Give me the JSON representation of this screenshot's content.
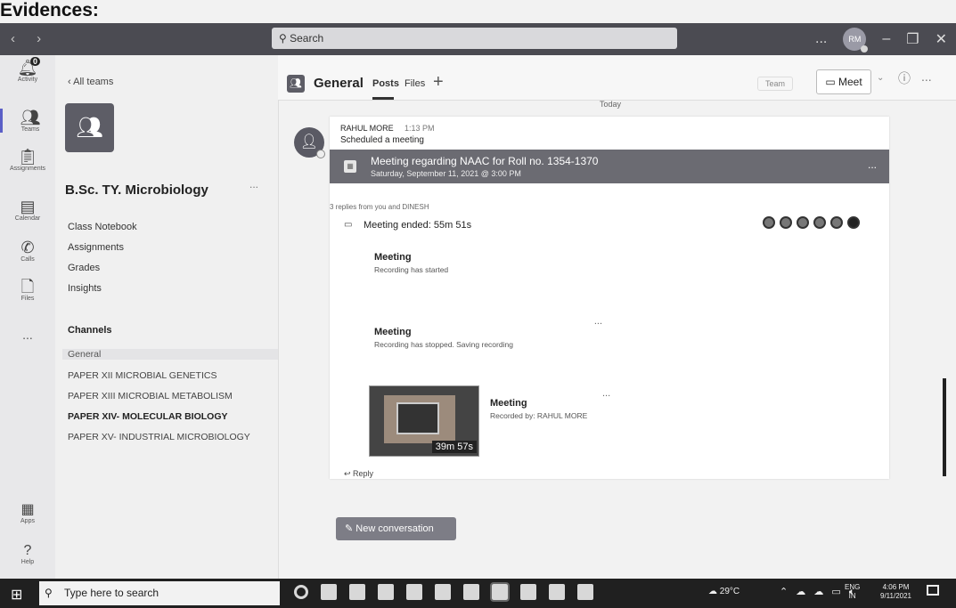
{
  "caption": "Evidences:",
  "topbar": {
    "nav": "‹ ›",
    "search_placeholder": "Search",
    "more": "...",
    "avatar_initials": "RM",
    "minimize": "–",
    "maximize": "❐",
    "close": "✕"
  },
  "rail": {
    "activity_label": "Activity",
    "activity_badge": "0",
    "teams_label": "Teams",
    "assignments_label": "Assignments",
    "calendar_label": "Calendar",
    "calls_label": "Calls",
    "files_label": "Files",
    "more": "...",
    "apps_label": "Apps",
    "help_label": "Help"
  },
  "teampanel": {
    "all_teams": "‹  All teams",
    "team_name": "B.Sc. TY. Microbiology",
    "team_more": "...",
    "links": [
      "Class Notebook",
      "Assignments",
      "Grades",
      "Insights"
    ],
    "channels_heading": "Channels",
    "channels": [
      "General",
      "PAPER XII MICROBIAL GENETICS",
      "PAPER XIII MICROBIAL METABOLISM",
      "PAPER XIV- MOLECULAR BIOLOGY",
      "PAPER XV- INDUSTRIAL MICROBIOLOGY"
    ]
  },
  "channel": {
    "title": "General",
    "tabs": [
      "Posts",
      "Files"
    ],
    "add": "+",
    "team_btn": "Team",
    "meet_btn": "Meet",
    "info": "ⓘ",
    "more": "..."
  },
  "conversation": {
    "day": "Today",
    "author": "RAHUL MORE",
    "time": "1:13 PM",
    "text": "Scheduled a meeting",
    "meeting_title": "Meeting regarding NAAC for Roll no. 1354-1370",
    "meeting_date": "Saturday, September 11, 2021 @ 3:00 PM",
    "meeting_more": "...",
    "replies": "3 replies from you and DINESH",
    "ended": "Meeting ended: 55m 51s",
    "cards": [
      {
        "title": "Meeting",
        "sub": "Recording has started"
      },
      {
        "title": "Meeting",
        "sub": "Recording has stopped. Saving recording"
      }
    ],
    "card_more": "...",
    "recording": {
      "title": "Meeting",
      "by": "Recorded by: RAHUL MORE",
      "duration": "39m 57s"
    },
    "reply": "↩ Reply"
  },
  "new_conversation": "New conversation",
  "taskbar": {
    "search_placeholder": "Type here to search",
    "weather": "29°C",
    "lang_top": "ENG",
    "lang_bottom": "IN",
    "time": "4:06 PM",
    "date": "9/11/2021"
  },
  "colors": {
    "topbar": "#4b4b52",
    "accent": "#5b5fc7",
    "meeting_bar": "#6b6b72",
    "taskbar": "#202020"
  }
}
